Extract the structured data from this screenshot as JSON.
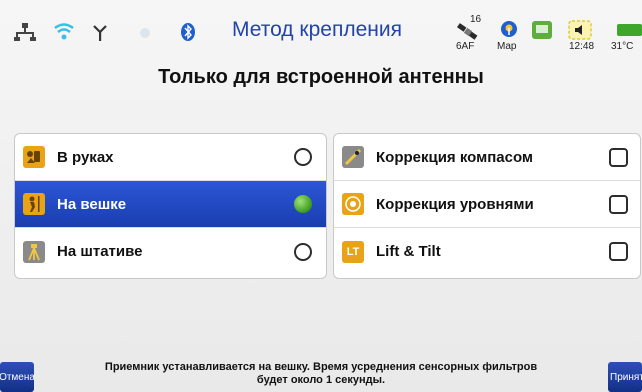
{
  "header": {
    "title": "Метод крепления",
    "satellite_count": "16",
    "satellite_label": "6AF",
    "map_label": "Map",
    "time": "12:48",
    "temperature": "31°C",
    "icons": [
      "network-icon",
      "wifi-icon",
      "antenna-icon",
      "bluetooth-icon",
      "satellite-icon",
      "map-icon",
      "controller-icon",
      "battery-icon"
    ]
  },
  "subtitle": "Только для встроенной антенны",
  "mount_options": [
    {
      "label": "В руках",
      "icon": "handheld-icon",
      "selected": false
    },
    {
      "label": "На вешке",
      "icon": "pole-icon",
      "selected": true
    },
    {
      "label": "На штативе",
      "icon": "tripod-icon",
      "selected": false
    }
  ],
  "corrections": [
    {
      "label": "Коррекция компасом",
      "icon": "compass-icon",
      "checked": false
    },
    {
      "label": "Коррекция уровнями",
      "icon": "level-icon",
      "checked": false
    },
    {
      "label": "Lift & Tilt",
      "icon": "lift-tilt-icon",
      "icon_text": "LT",
      "checked": false
    }
  ],
  "footer": {
    "message_line1": "Приемник устанавливается на вешку. Время усреднения сенсорных фильтров",
    "message_line2": "будет около 1 секунды.",
    "cancel_label": "Отмена",
    "accept_label": "Принять"
  },
  "colors": {
    "accent": "#2244a8",
    "selected_row": "#1e48c8",
    "radio_on": "#4caf25",
    "icon_orange": "#e8a317"
  }
}
